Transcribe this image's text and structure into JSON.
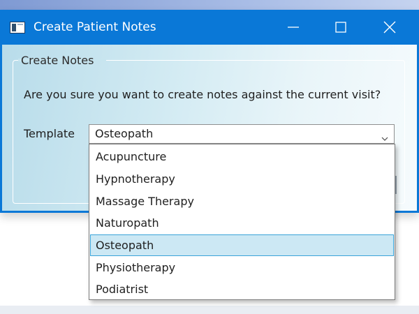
{
  "window": {
    "title": "Create Patient Notes",
    "controls": {
      "minimize": "minimize-icon",
      "maximize": "maximize-icon",
      "close": "close-icon"
    }
  },
  "groupbox": {
    "title": "Create Notes"
  },
  "prompt": "Are you sure you want to create notes against the current visit?",
  "template": {
    "label": "Template",
    "selected": "Osteopath",
    "options": [
      "Acupuncture",
      "Hypnotherapy",
      "Massage Therapy",
      "Naturopath",
      "Osteopath",
      "Physiotherapy",
      "Podiatrist"
    ],
    "selected_index": 4
  },
  "colors": {
    "titlebar": "#0a78d7",
    "selection_fill": "#cce8f4",
    "selection_border": "#39a3d8"
  }
}
